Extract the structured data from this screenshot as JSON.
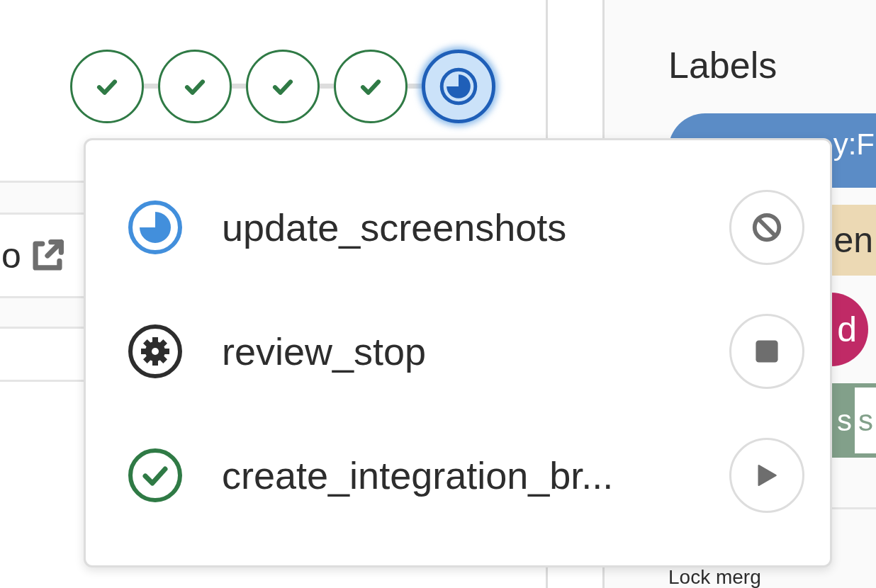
{
  "pipeline": {
    "stages": [
      {
        "kind": "success",
        "selected": false
      },
      {
        "kind": "success",
        "selected": false
      },
      {
        "kind": "success",
        "selected": false
      },
      {
        "kind": "success",
        "selected": false
      },
      {
        "kind": "running",
        "selected": true
      }
    ]
  },
  "background_row": {
    "text": "o"
  },
  "sidebar": {
    "heading": "Labels",
    "labels": [
      {
        "kind": "pill",
        "text": "y:F",
        "color": "#5b8cc6"
      },
      {
        "kind": "tag",
        "text": "en",
        "color": "#ecd9b4"
      },
      {
        "kind": "round",
        "text": "d",
        "color": "#c02a66"
      },
      {
        "kind": "scoped",
        "text": "s",
        "scope": "s",
        "color": "#82a08a"
      }
    ],
    "next_heading": "Lock merg"
  },
  "jobs_dropdown": {
    "jobs": [
      {
        "name": "update_screenshots",
        "kind": "running",
        "action": {
          "kind": "cancel"
        }
      },
      {
        "name": "review_stop",
        "kind": "manual",
        "action": {
          "kind": "stop"
        }
      },
      {
        "name": "create_integration_br...",
        "kind": "success",
        "action": {
          "kind": "play"
        }
      }
    ]
  }
}
